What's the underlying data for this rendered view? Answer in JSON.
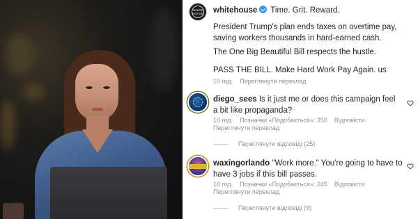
{
  "post": {
    "username": "whitehouse",
    "tagline": "Time. Grit. Reward.",
    "avatar_text": "WHITE HOUSE",
    "caption_p1": "President Trump's plan ends taxes on overtime pay, saving workers thousands in hard-earned cash.",
    "caption_p2": "The One Big Beautiful Bill respects the hustle.",
    "caption_p3": "PASS THE BILL. Make Hard Work Pay Again. us",
    "time": "10 год.",
    "see_translation": "Переглянути переклад"
  },
  "comments": [
    {
      "username": "diego_sees",
      "text": "Is it just me or does this campaign feel a bit like propaganda?",
      "time": "10 год.",
      "likes": "Позначки «Подобається»: 350",
      "reply": "Відповісти",
      "see_translation": "Переглянути переклад",
      "view_replies": "Переглянути відповіді (25)"
    },
    {
      "username": "waxingorlando",
      "text": "\"Work more.\" You're going to have to have 3 jobs if this bill passes.",
      "time": "10 год.",
      "likes": "Позначки «Подобається»: 245",
      "reply": "Відповісти",
      "see_translation": "Переглянути переклад",
      "view_replies": "Переглянути відповіді (9)"
    }
  ],
  "icons": {
    "verified": "verified-badge-icon",
    "like": "heart-outline-icon"
  },
  "colors": {
    "text": "#262626",
    "secondary": "#8e8e8e",
    "verified": "#3897f0"
  }
}
